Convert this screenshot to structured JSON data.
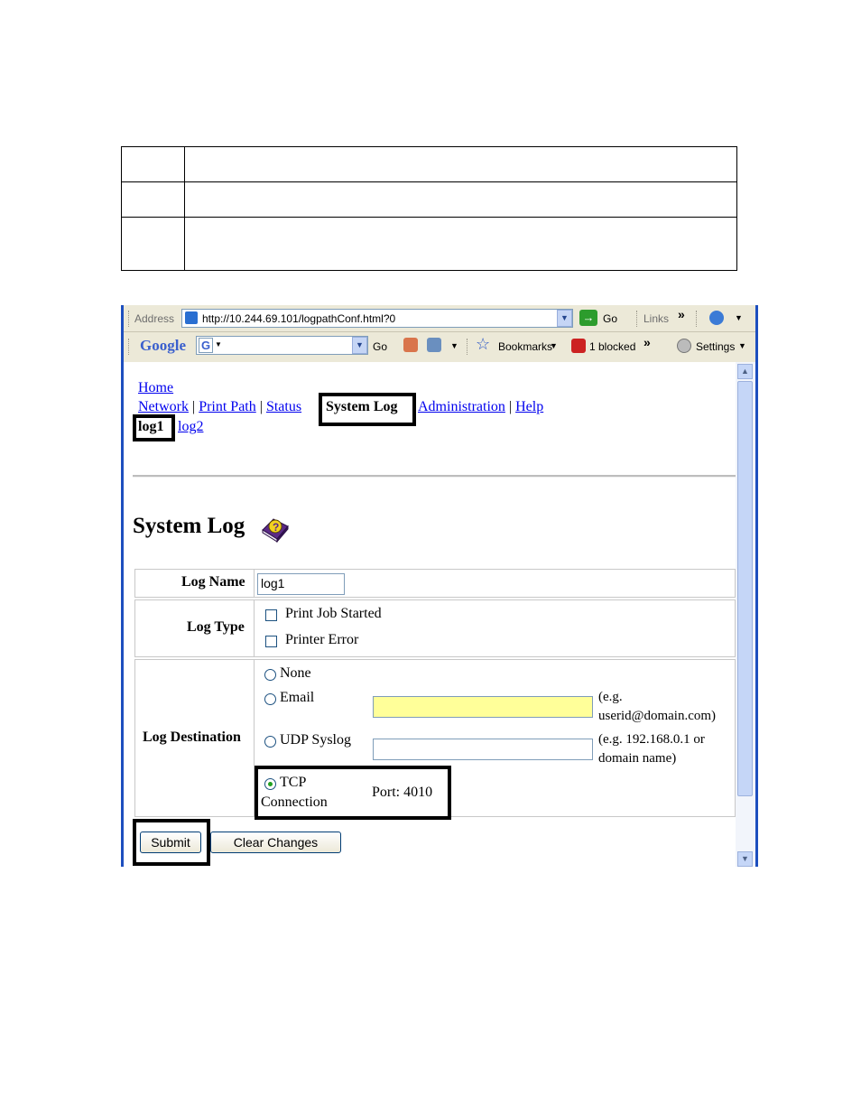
{
  "browser": {
    "address_label": "Address",
    "url": "http://10.244.69.101/logpathConf.html?0",
    "go_label": "Go",
    "links_label": "Links",
    "chevron": "»",
    "google_logo": "Google",
    "google_g": "G",
    "google_go": "Go",
    "bookmarks_label": "Bookmarks",
    "blocked_label": "1 blocked",
    "settings_label": "Settings"
  },
  "nav": {
    "home": "Home",
    "network": "Network",
    "print_path": "Print Path",
    "status": "Status",
    "system_log": "System Log",
    "administration": "Administration",
    "help": "Help",
    "separator": "|",
    "log1": "log1",
    "log2": "log2"
  },
  "page": {
    "title": "System Log"
  },
  "form": {
    "log_name_label": "Log Name",
    "log_name_value": "log1",
    "log_type_label": "Log Type",
    "log_type_options": [
      "Print Job Started",
      "Printer Error"
    ],
    "log_destination_label": "Log Destination",
    "destination_none": "None",
    "destination_email": "Email",
    "email_hint_1": "(e.g.",
    "email_hint_2": "userid@domain.com)",
    "destination_udp": "UDP Syslog",
    "udp_hint_1": "(e.g. 192.168.0.1 or",
    "udp_hint_2": "domain name)",
    "destination_tcp_1": "TCP",
    "destination_tcp_2": "Connection",
    "port_text": "Port: 4010",
    "selected_destination": "TCP Connection"
  },
  "buttons": {
    "submit": "Submit",
    "clear": "Clear Changes"
  },
  "colors": {
    "email_field_bg": "#ffff99",
    "link": "#0000ee",
    "highlight_border": "#000000"
  }
}
